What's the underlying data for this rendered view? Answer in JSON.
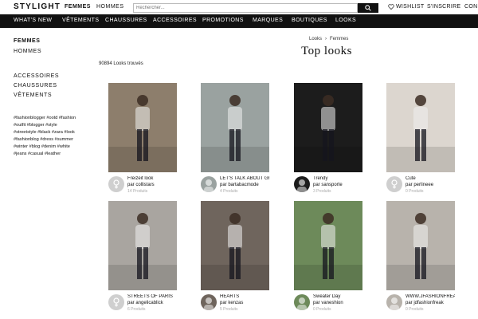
{
  "header": {
    "logo": "STYLIGHT",
    "gender_women": "FEMMES",
    "gender_men": "HOMMES",
    "search_placeholder": "Rechercher...",
    "wishlist": "WISHLIST",
    "signup": "S'INSCRIRE",
    "login": "CON"
  },
  "nav": {
    "items": [
      "WHAT'S NEW",
      "VÊTEMENTS",
      "CHAUSSURES",
      "ACCESSOIRES",
      "PROMOTIONS",
      "MARQUES",
      "BOUTIQUES",
      "LOOKS"
    ]
  },
  "sidebar": {
    "genders": [
      "FEMMES",
      "HOMMES"
    ],
    "categories": [
      "ACCESSOIRES",
      "CHAUSSURES",
      "VÊTEMENTS"
    ],
    "tags": [
      "#fashionblogger #ootd #fashion",
      "#outfit #blogger #style",
      "#streetstyle #black #zara #look",
      "#fashionblog #dress #summer",
      "#winter #blog #denim #white",
      "#jeans #casual #leather"
    ]
  },
  "breadcrumb": [
    "Looks",
    "Femmes"
  ],
  "page_title": "Top looks",
  "results_count": "90894 Looks trouvés",
  "looks": [
    {
      "title": "Freizeit look",
      "author": "par collistars",
      "products": "14 Produits",
      "avatar": "placeholder",
      "bg": "#8d7e6c"
    },
    {
      "title": "LET'S TALK ABOUT GREY",
      "author": "par bartabacmode",
      "products": "4 Produits",
      "avatar": "photo",
      "bg": "#9aa2a0"
    },
    {
      "title": "Trendy",
      "author": "par sansporte",
      "products": "3 Produits",
      "avatar": "photo",
      "bg": "#1c1c1c"
    },
    {
      "title": "Cute",
      "author": "par perlineee",
      "products": "0 Produits",
      "avatar": "placeholder",
      "bg": "#dcd6cf"
    },
    {
      "title": "STREETS OF PARIS",
      "author": "par angelicablick",
      "products": "6 Produits",
      "avatar": "placeholder",
      "bg": "#a9a5a0"
    },
    {
      "title": "HEARTS",
      "author": "par kenzas",
      "products": "5 Produits",
      "avatar": "photo",
      "bg": "#6f655d"
    },
    {
      "title": "Sweater Day",
      "author": "par vaneshion",
      "products": "0 Produits",
      "avatar": "photo",
      "bg": "#6d8a5a"
    },
    {
      "title": "WWW.JFASHIONFREAK",
      "author": "par jdfashionfreak",
      "products": "0 Produits",
      "avatar": "photo",
      "bg": "#b8b3ac"
    }
  ]
}
